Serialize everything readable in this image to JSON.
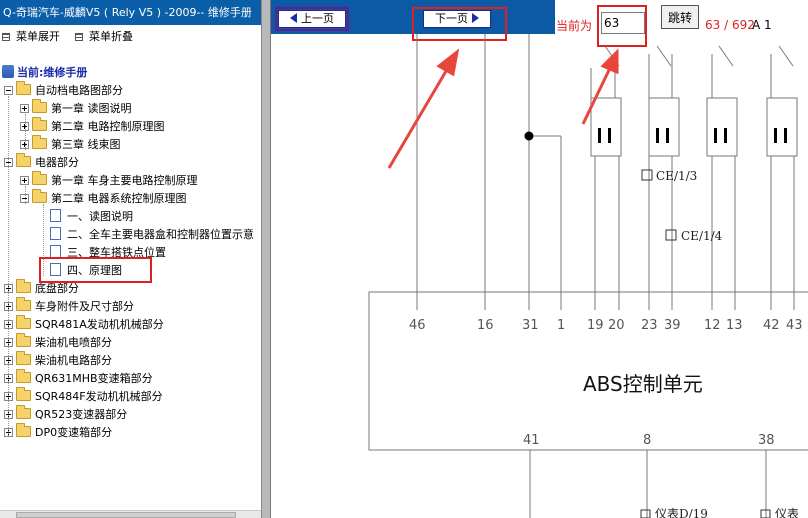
{
  "left": {
    "title": "Q-奇瑞汽车-威麟V5 ( Rely V5 ) -2009-- 维修手册",
    "toolbar": {
      "expand": "菜单展开",
      "collapse": "菜单折叠"
    },
    "current": "当前:维修手册",
    "tree": [
      {
        "label": "自动档电路图部分",
        "level": 0,
        "kind": "folder",
        "state": "minus"
      },
      {
        "label": "第一章 读图说明",
        "level": 1,
        "kind": "folder",
        "state": "plus"
      },
      {
        "label": "第二章 电路控制原理图",
        "level": 1,
        "kind": "folder",
        "state": "plus"
      },
      {
        "label": "第三章 线束图",
        "level": 1,
        "kind": "folder",
        "state": "plus"
      },
      {
        "label": "电器部分",
        "level": 0,
        "kind": "folder",
        "state": "minus"
      },
      {
        "label": "第一章 车身主要电路控制原理",
        "level": 1,
        "kind": "folder",
        "state": "plus"
      },
      {
        "label": "第二章 电器系统控制原理图",
        "level": 1,
        "kind": "folder",
        "state": "minus"
      },
      {
        "label": "一、读图说明",
        "level": 2,
        "kind": "doc"
      },
      {
        "label": "二、全车主要电器盒和控制器位置示意",
        "level": 2,
        "kind": "doc"
      },
      {
        "label": "三、整车搭铁点位置",
        "level": 2,
        "kind": "doc"
      },
      {
        "label": "四、原理图",
        "level": 2,
        "kind": "doc"
      },
      {
        "label": "底盘部分",
        "level": 0,
        "kind": "folder",
        "state": "plus"
      },
      {
        "label": "车身附件及尺寸部分",
        "level": 0,
        "kind": "folder",
        "state": "plus"
      },
      {
        "label": "SQR481A发动机机械部分",
        "level": 0,
        "kind": "folder",
        "state": "plus"
      },
      {
        "label": "柴油机电喷部分",
        "level": 0,
        "kind": "folder",
        "state": "plus"
      },
      {
        "label": "柴油机电路部分",
        "level": 0,
        "kind": "folder",
        "state": "plus"
      },
      {
        "label": "QR631MHB变速箱部分",
        "level": 0,
        "kind": "folder",
        "state": "plus"
      },
      {
        "label": "SQR484F发动机机械部分",
        "level": 0,
        "kind": "folder",
        "state": "plus"
      },
      {
        "label": "QR523变速器部分",
        "level": 0,
        "kind": "folder",
        "state": "plus"
      },
      {
        "label": "DP0变速箱部分",
        "level": 0,
        "kind": "folder",
        "state": "plus"
      }
    ]
  },
  "nav": {
    "prev": "上一页",
    "next": "下一页",
    "current_label": "当前为",
    "page_value": "63",
    "jump": "跳转",
    "page_count": "63 / 692",
    "page_suffix": "A 1"
  },
  "diagram": {
    "unit_label": "ABS控制单元",
    "top_pins": [
      "46",
      "16",
      "31",
      "1",
      "19",
      "20",
      "23",
      "39",
      "12",
      "13",
      "42",
      "43"
    ],
    "bottom_pins": [
      "41",
      "8",
      "38"
    ],
    "connector_labels": [
      "CE/1/3",
      "CE/1/4"
    ],
    "bottom_labels": [
      "仪表D/19",
      "仪表"
    ]
  },
  "colors": {
    "accent": "#0c5aa6",
    "highlight": "#e02020"
  }
}
